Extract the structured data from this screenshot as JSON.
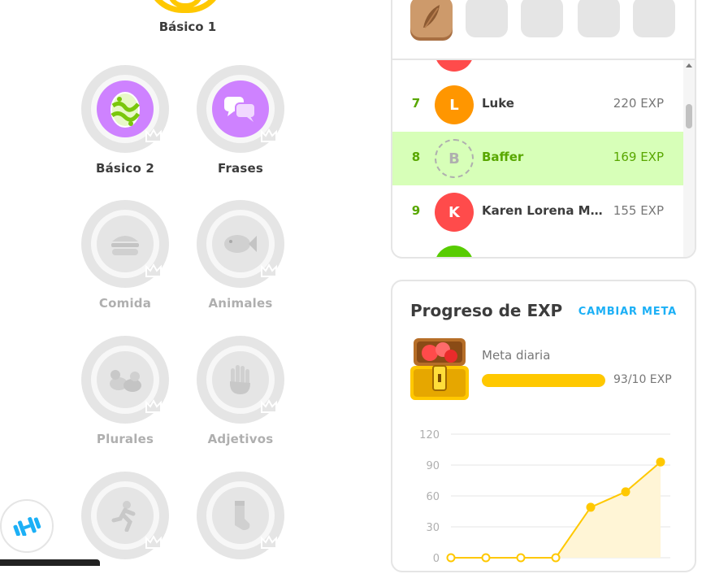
{
  "tree": {
    "top_skill": "Básico 1",
    "skills": [
      {
        "label": "Básico 2",
        "state": "active",
        "icon": "egg-icon"
      },
      {
        "label": "Frases",
        "state": "active",
        "icon": "speech-bubbles-icon"
      },
      {
        "label": "Comida",
        "state": "locked",
        "icon": "burger-icon"
      },
      {
        "label": "Animales",
        "state": "locked",
        "icon": "fish-icon"
      },
      {
        "label": "Plurales",
        "state": "locked",
        "icon": "ducks-icon"
      },
      {
        "label": "Adjetivos",
        "state": "locked",
        "icon": "hand-icon"
      },
      {
        "label": "",
        "state": "locked",
        "icon": "running-person-icon"
      },
      {
        "label": "",
        "state": "locked",
        "icon": "sock-icon"
      }
    ]
  },
  "league": {
    "rows": [
      {
        "rank": "7",
        "initial": "L",
        "name": "Luke",
        "xp": "220 EXP",
        "color": "#ff9600"
      },
      {
        "rank": "8",
        "initial": "B",
        "name": "Baffer",
        "xp": "169 EXP",
        "me": true
      },
      {
        "rank": "9",
        "initial": "K",
        "name": "Karen Lorena Mat...",
        "xp": "155 EXP",
        "color": "#ff4b4b"
      }
    ]
  },
  "progress": {
    "title": "Progreso de EXP",
    "change_goal": "CAMBIAR META",
    "daily_goal_label": "Meta diaria",
    "daily_goal_value": "93/10 EXP",
    "goal_fraction": 1.0
  },
  "chart_data": {
    "type": "area",
    "title": "",
    "xlabel": "",
    "ylabel": "",
    "ylim": [
      0,
      120
    ],
    "yticks": [
      0,
      30,
      60,
      90,
      120
    ],
    "x": [
      1,
      2,
      3,
      4,
      5,
      6,
      7
    ],
    "values": [
      0,
      0,
      0,
      0,
      49,
      64,
      93
    ],
    "color": "#ffc800"
  },
  "colors": {
    "accent_green": "#58a700",
    "highlight_green": "#d7ffb8",
    "link_blue": "#1cb0f6",
    "gold": "#ffc800",
    "purple": "#ce82ff"
  }
}
